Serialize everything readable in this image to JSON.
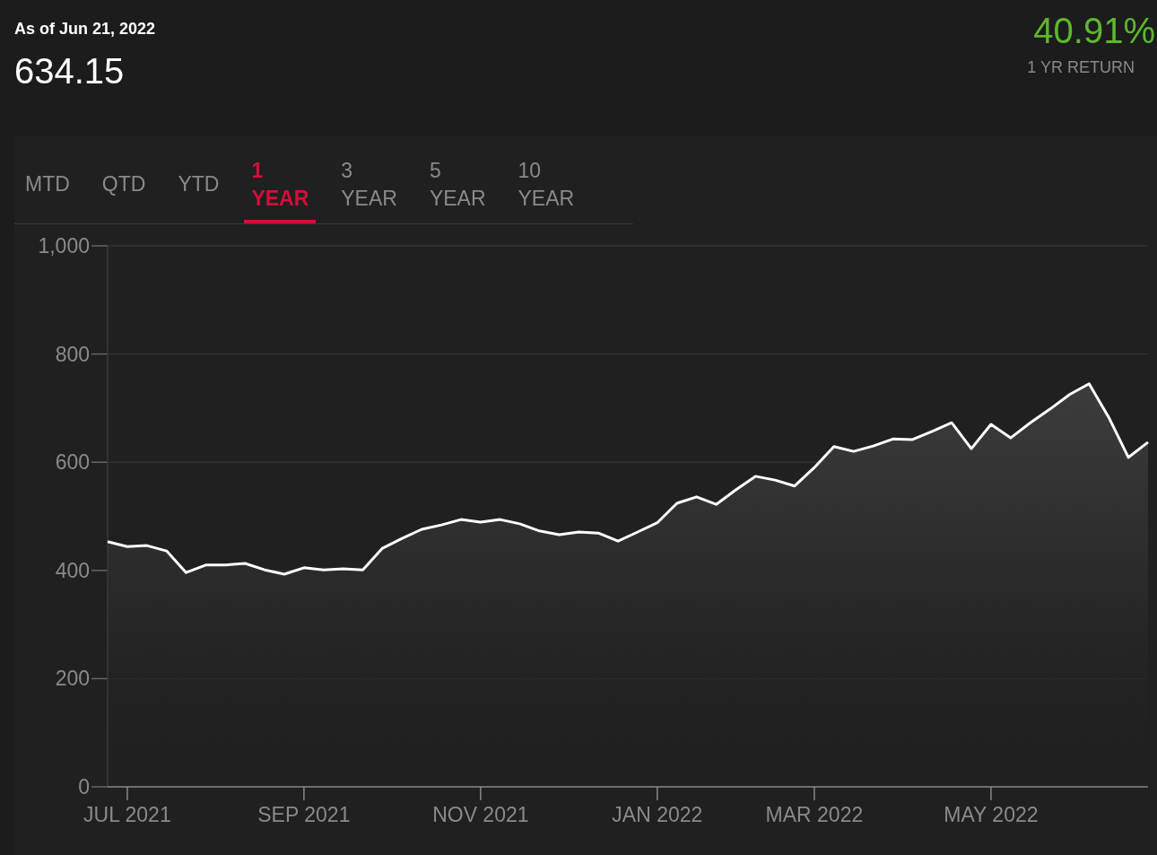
{
  "header": {
    "as_of": "As of Jun 21, 2022",
    "price": "634.15",
    "return_value": "40.91%",
    "return_label": "1 YR RETURN"
  },
  "tabs": [
    {
      "label": "MTD",
      "selected": false
    },
    {
      "label": "QTD",
      "selected": false
    },
    {
      "label": "YTD",
      "selected": false
    },
    {
      "label": "1 YEAR",
      "selected": true
    },
    {
      "label": "3 YEAR",
      "selected": false
    },
    {
      "label": "5 YEAR",
      "selected": false
    },
    {
      "label": "10 YEAR",
      "selected": false
    }
  ],
  "chart": {
    "chart_data": {
      "type": "area",
      "categories": [
        null,
        "JUL 2021",
        null,
        null,
        null,
        null,
        null,
        null,
        null,
        null,
        "SEP 2021",
        null,
        null,
        null,
        null,
        null,
        null,
        null,
        null,
        "NOV 2021",
        null,
        null,
        null,
        null,
        null,
        null,
        null,
        null,
        "JAN 2022",
        null,
        null,
        null,
        null,
        null,
        null,
        null,
        "MAR 2022",
        null,
        null,
        null,
        null,
        null,
        null,
        null,
        null,
        "MAY 2022",
        null,
        null,
        null,
        null,
        null,
        null,
        null,
        null
      ],
      "series": [
        {
          "color": "#ffffff",
          "values": [
            453,
            444,
            446,
            436,
            396,
            410,
            410,
            413,
            401,
            393,
            405,
            401,
            403,
            401,
            441,
            459,
            476,
            484,
            494,
            489,
            494,
            486,
            473,
            466,
            471,
            469,
            454,
            471,
            488,
            524,
            536,
            522,
            549,
            574,
            567,
            556,
            590,
            629,
            620,
            630,
            643,
            642,
            657,
            673,
            625,
            670,
            645,
            673,
            698,
            725,
            745,
            683,
            609,
            637
          ]
        }
      ],
      "ylim": [
        0,
        1000
      ],
      "grid": true,
      "yticks": [
        {
          "value": 0,
          "label": "0"
        },
        {
          "value": 200,
          "label": "200"
        },
        {
          "value": 400,
          "label": "400"
        },
        {
          "value": 600,
          "label": "600"
        },
        {
          "value": 800,
          "label": "800"
        },
        {
          "value": 1000,
          "label": "1,000"
        }
      ]
    }
  }
}
